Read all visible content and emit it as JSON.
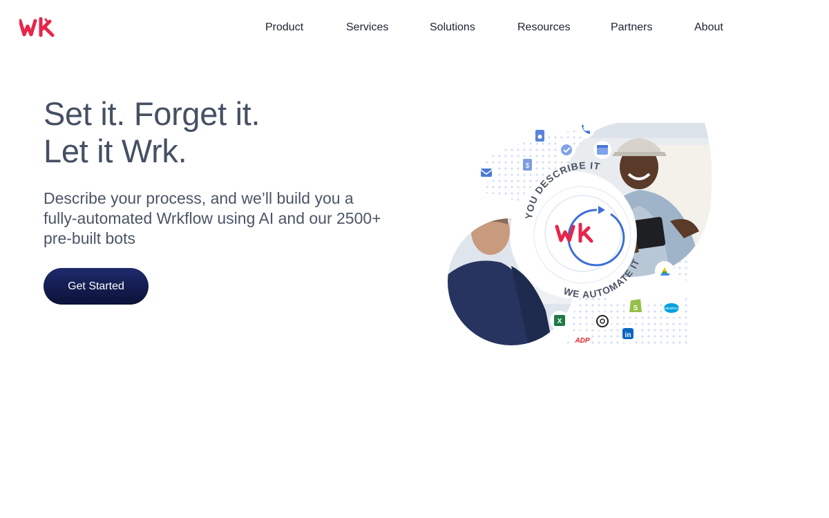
{
  "brand": {
    "logo_text": "wk",
    "color": "#e8254a"
  },
  "nav": {
    "items": [
      "Product",
      "Services",
      "Solutions",
      "Resources",
      "Partners",
      "About"
    ]
  },
  "hero": {
    "title_line1": "Set it. Forget it.",
    "title_line2": "Let it Wrk.",
    "subtitle": "Describe your process, and we’ll build you a fully-automated Wrkflow using AI and our 2500+ pre-built bots",
    "cta_label": "Get Started"
  },
  "illustration": {
    "arc_top_text": "YOU DESCRIBE IT",
    "arc_bottom_text": "WE AUTOMATE IT",
    "center_logo_text": "wk",
    "badges": {
      "adp": "ADP",
      "salesforce": "salesforce",
      "linkedin": "in",
      "excel": "X"
    },
    "colors": {
      "accent_blue": "#3a6ed8",
      "navy": "#1c2c6b"
    }
  }
}
